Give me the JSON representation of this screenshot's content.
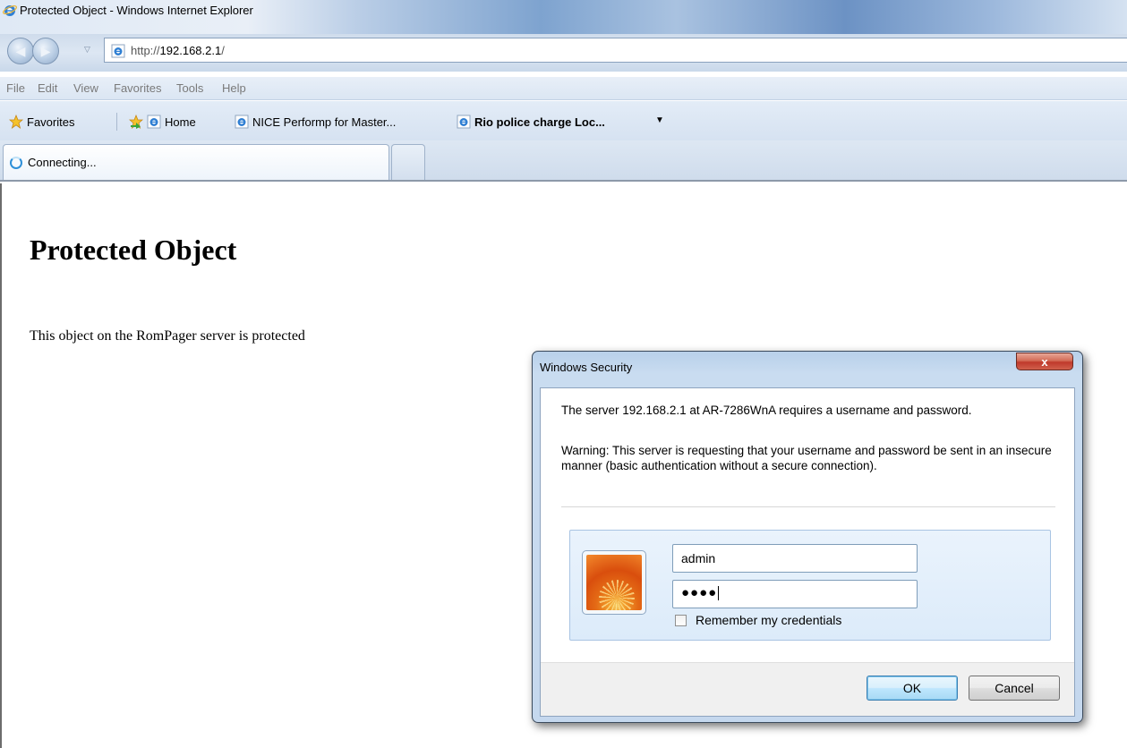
{
  "window": {
    "title": "Protected Object - Windows Internet Explorer"
  },
  "address_bar": {
    "url_prefix": "http://",
    "url_host": "192.168.2.1",
    "url_suffix": "/"
  },
  "menu": {
    "items": [
      "File",
      "Edit",
      "View",
      "Favorites",
      "Tools",
      "Help"
    ]
  },
  "favorites_bar": {
    "favorites_label": "Favorites",
    "links": [
      "Home",
      "NICE Performp for Master...",
      "Rio police charge Loc..."
    ]
  },
  "tabs": {
    "active_label": "Connecting..."
  },
  "page": {
    "heading": "Protected Object",
    "body_text": "This object on the RomPager server is protected"
  },
  "dialog": {
    "title": "Windows Security",
    "close_label": "x",
    "message": "The server 192.168.2.1 at AR-7286WnA requires a username and password.",
    "warning": "Warning: This server is requesting that your username and password be sent in an insecure manner (basic authentication without a secure connection).",
    "username_value": "admin",
    "password_mask": "●●●●",
    "remember_label": "Remember my credentials",
    "remember_checked": false,
    "ok_label": "OK",
    "cancel_label": "Cancel"
  },
  "icons": {
    "browser": "ie-icon",
    "back": "back-arrow-icon",
    "forward": "forward-arrow-icon",
    "favorites": "star-icon",
    "loading": "spinner-icon",
    "user": "user-picture-icon"
  }
}
